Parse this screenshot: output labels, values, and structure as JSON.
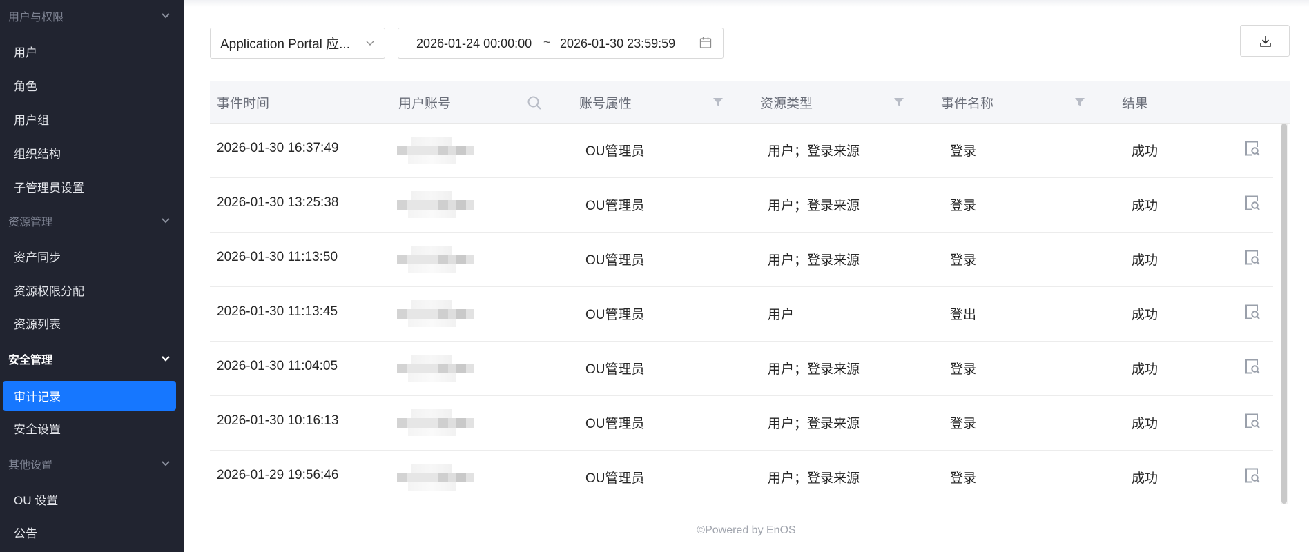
{
  "sidebar": {
    "groups": [
      {
        "label": "用户与权限",
        "items": [
          "用户",
          "角色",
          "用户组",
          "组织结构",
          "子管理员设置"
        ]
      },
      {
        "label": "资源管理",
        "items": [
          "资产同步",
          "资源权限分配",
          "资源列表"
        ]
      },
      {
        "label": "安全管理",
        "items": [
          "审计记录",
          "安全设置"
        ]
      },
      {
        "label": "其他设置",
        "items": [
          "OU 设置",
          "公告"
        ]
      }
    ],
    "selected_item": "审计记录"
  },
  "filters": {
    "app_select": "Application Portal 应...",
    "date_start": "2026-01-24 00:00:00",
    "date_sep": "~",
    "date_end": "2026-01-30 23:59:59"
  },
  "table": {
    "columns": [
      "事件时间",
      "用户账号",
      "账号属性",
      "资源类型",
      "事件名称",
      "结果"
    ],
    "rows": [
      {
        "time": "2026-01-30 16:37:49",
        "attr": "OU管理员",
        "resource": "用户；登录来源",
        "event": "登录",
        "result": "成功"
      },
      {
        "time": "2026-01-30 13:25:38",
        "attr": "OU管理员",
        "resource": "用户；登录来源",
        "event": "登录",
        "result": "成功"
      },
      {
        "time": "2026-01-30 11:13:50",
        "attr": "OU管理员",
        "resource": "用户；登录来源",
        "event": "登录",
        "result": "成功"
      },
      {
        "time": "2026-01-30 11:13:45",
        "attr": "OU管理员",
        "resource": "用户",
        "event": "登出",
        "result": "成功"
      },
      {
        "time": "2026-01-30 11:04:05",
        "attr": "OU管理员",
        "resource": "用户；登录来源",
        "event": "登录",
        "result": "成功"
      },
      {
        "time": "2026-01-30 10:16:13",
        "attr": "OU管理员",
        "resource": "用户；登录来源",
        "event": "登录",
        "result": "成功"
      },
      {
        "time": "2026-01-29 19:56:46",
        "attr": "OU管理员",
        "resource": "用户；登录来源",
        "event": "登录",
        "result": "成功"
      }
    ]
  },
  "footer": "©Powered by EnOS",
  "colors": {
    "sidebar_bg": "#212430",
    "accent": "#1677ff",
    "header_bg": "#f5f6f9"
  }
}
